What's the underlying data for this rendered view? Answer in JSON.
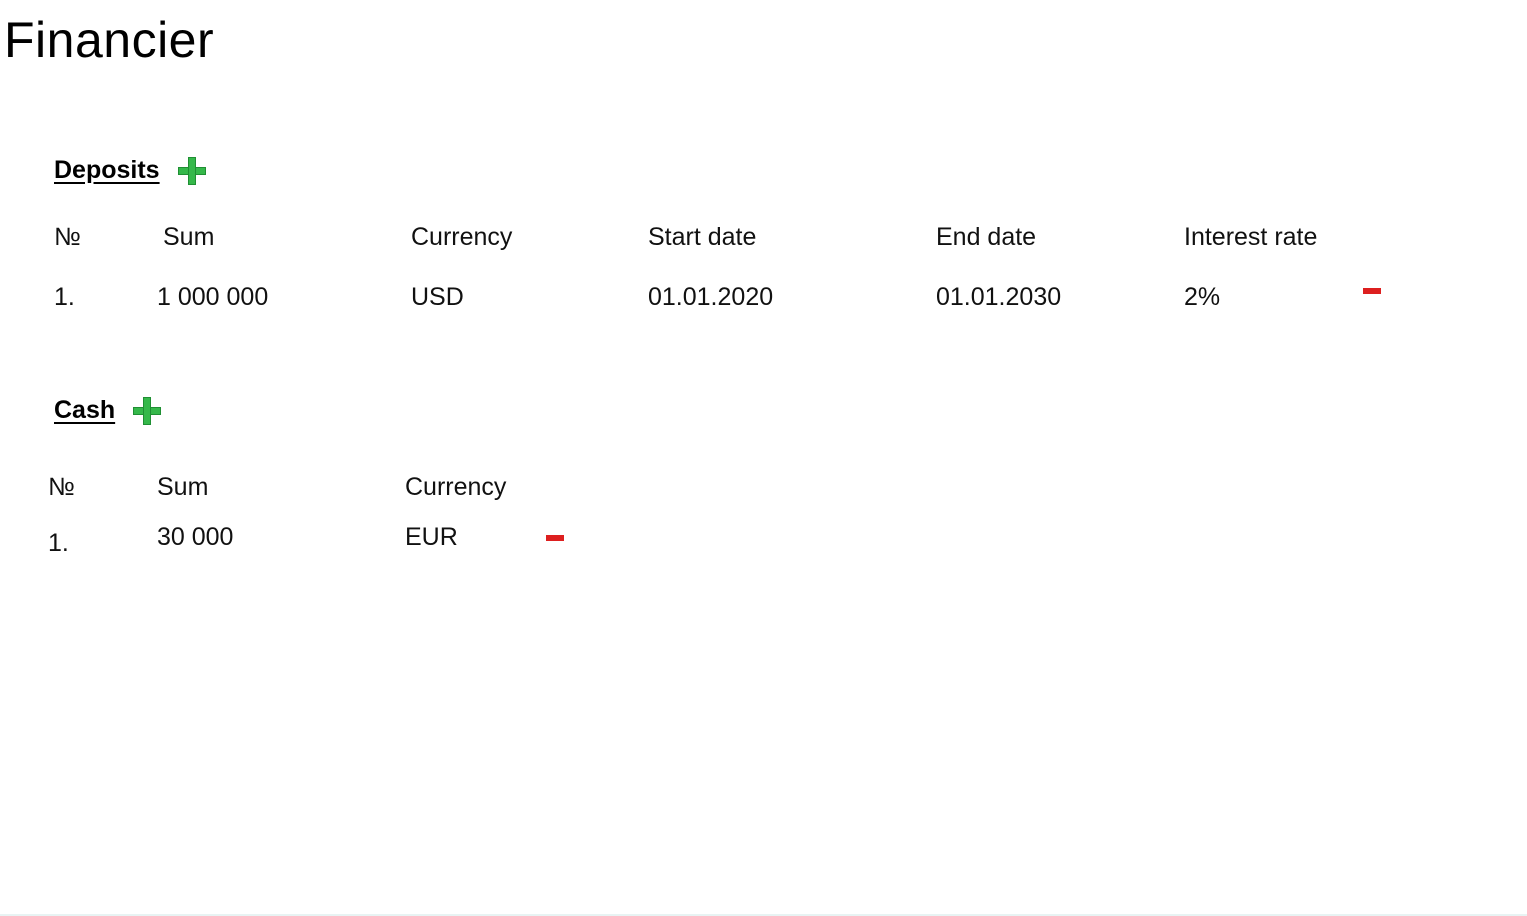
{
  "app": {
    "title": "Financier"
  },
  "deposits": {
    "title": "Deposits",
    "add_icon": "plus-icon",
    "columns": [
      "№",
      "Sum",
      "Currency",
      "Start date",
      "End date",
      "Interest rate"
    ],
    "rows": [
      {
        "index": "1.",
        "sum": "1 000 000",
        "currency": "USD",
        "start_date": "01.01.2020",
        "end_date": "01.01.2030",
        "interest_rate": "2%"
      }
    ],
    "remove_icon": "minus-icon"
  },
  "cash": {
    "title": "Cash",
    "add_icon": "plus-icon",
    "columns": [
      "№",
      "Sum",
      "Currency"
    ],
    "rows": [
      {
        "index": "1.",
        "sum": "30 000",
        "currency": "EUR"
      }
    ],
    "remove_icon": "minus-icon"
  },
  "colors": {
    "add": "#35b84a",
    "remove": "#dd1f1f"
  }
}
